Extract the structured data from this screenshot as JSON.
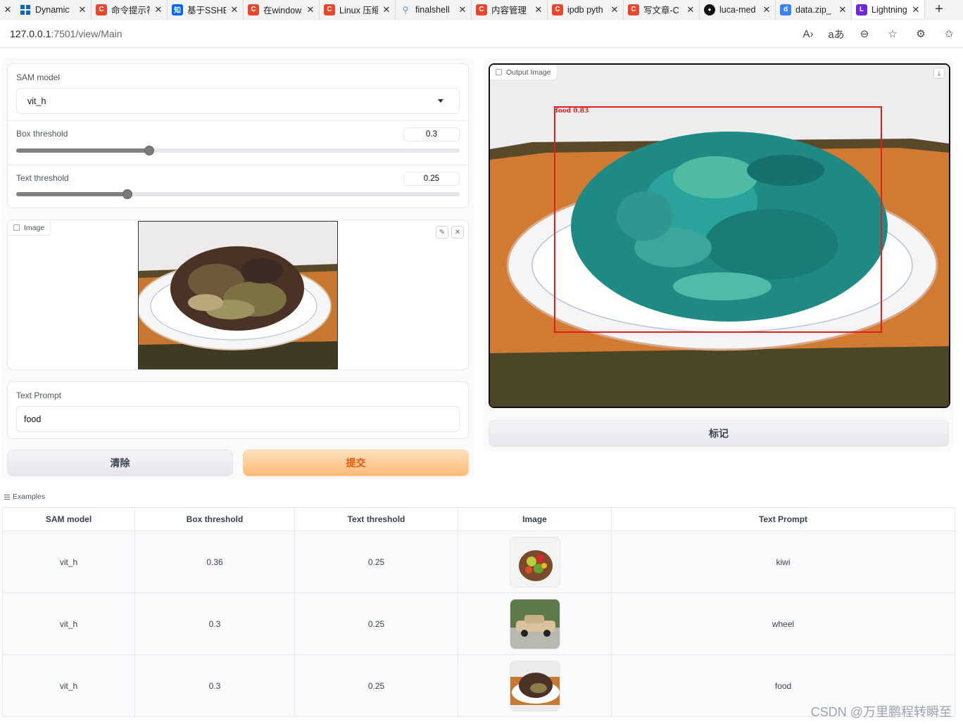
{
  "browser": {
    "tabs": [
      {
        "title": "Dynamic",
        "fav_color": "#0a66c2",
        "fav": "win"
      },
      {
        "title": "命令提示符",
        "fav_color": "#e8472b",
        "fav": "C"
      },
      {
        "title": "基于SSHE",
        "fav_color": "#0066ff",
        "fav": "知"
      },
      {
        "title": "在windows",
        "fav_color": "#e8472b",
        "fav": "C"
      },
      {
        "title": "Linux 压缩",
        "fav_color": "#e8472b",
        "fav": "C"
      },
      {
        "title": "finalshell",
        "fav_color": "#5b8def",
        "fav": "search"
      },
      {
        "title": "内容管理",
        "fav_color": "#e8472b",
        "fav": "C"
      },
      {
        "title": "ipdb pyth",
        "fav_color": "#e8472b",
        "fav": "C"
      },
      {
        "title": "写文章-C",
        "fav_color": "#e8472b",
        "fav": "C"
      },
      {
        "title": "luca-med",
        "fav_color": "#111111",
        "fav": "gh"
      },
      {
        "title": "data.zip_",
        "fav_color": "#3b82f6",
        "fav": "d"
      },
      {
        "title": "Lightning",
        "fav_color": "#6d28d9",
        "fav": "L"
      }
    ],
    "new_tab": "+",
    "url_host": "127.0.0.1",
    "url_path": ":7501/view/Main"
  },
  "sam": {
    "label": "SAM model",
    "value": "vit_h"
  },
  "box_threshold": {
    "label": "Box threshold",
    "value": "0.3",
    "fraction": 0.3
  },
  "text_threshold": {
    "label": "Text threshold",
    "value": "0.25",
    "fraction": 0.25
  },
  "image_input": {
    "label": "Image"
  },
  "text_prompt": {
    "label": "Text Prompt",
    "value": "food"
  },
  "buttons": {
    "clear": "清除",
    "submit": "提交",
    "mark": "标记"
  },
  "output": {
    "label": "Output Image",
    "box_label": "food 0.83"
  },
  "examples": {
    "label": "Examples",
    "headers": [
      "SAM model",
      "Box threshold",
      "Text threshold",
      "Image",
      "Text Prompt"
    ],
    "rows": [
      {
        "model": "vit_h",
        "box": "0.36",
        "text": "0.25",
        "prompt": "kiwi"
      },
      {
        "model": "vit_h",
        "box": "0.3",
        "text": "0.25",
        "prompt": "wheel"
      },
      {
        "model": "vit_h",
        "box": "0.3",
        "text": "0.25",
        "prompt": "food"
      }
    ]
  },
  "watermark": "CSDN @万里鹏程转瞬至"
}
